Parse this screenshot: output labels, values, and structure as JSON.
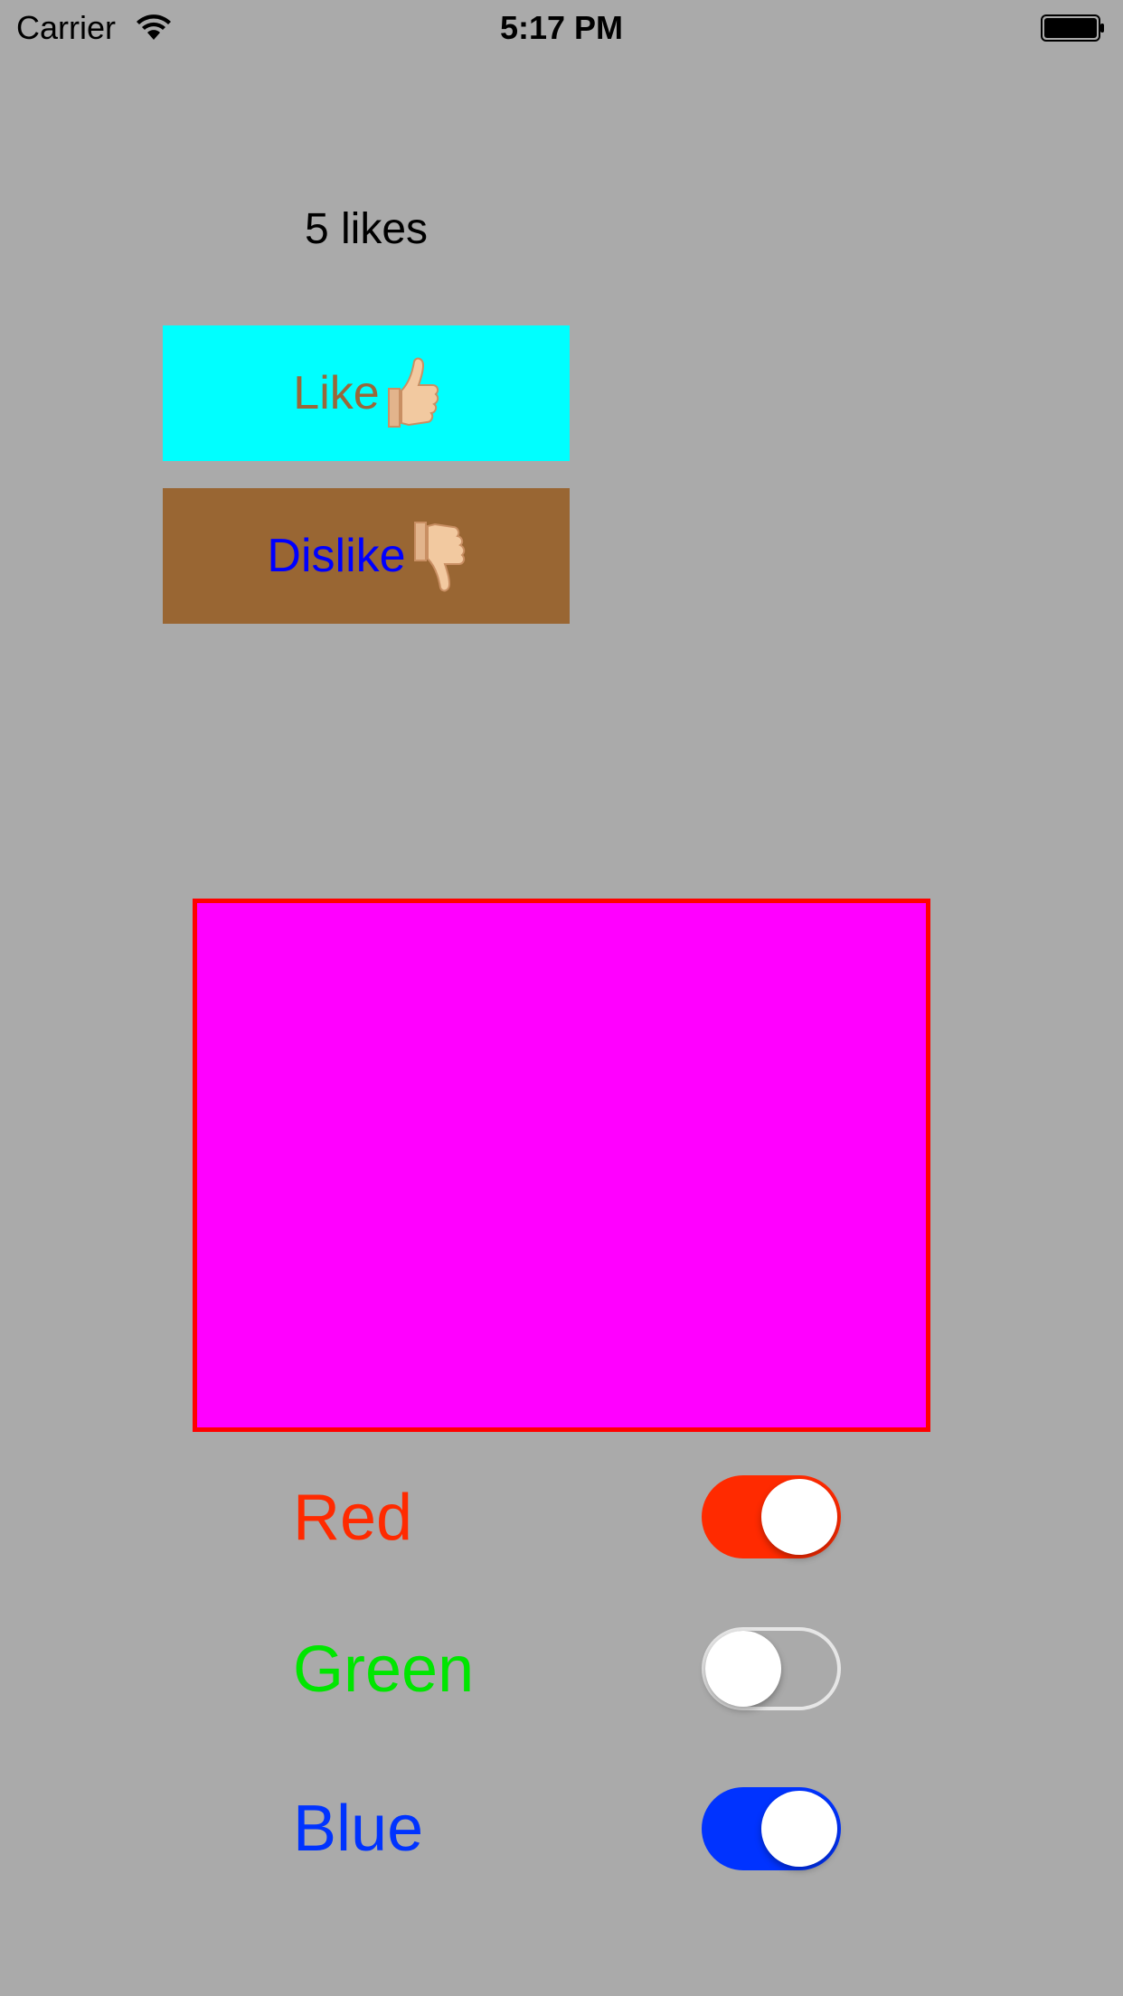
{
  "status_bar": {
    "carrier": "Carrier",
    "time": "5:17 PM"
  },
  "likes": {
    "count_label": "5 likes"
  },
  "buttons": {
    "like_label": "Like",
    "like_bg": "#00ffff",
    "like_text_color": "#99673a",
    "dislike_label": "Dislike",
    "dislike_bg": "#996633",
    "dislike_text_color": "#0000ff"
  },
  "color_box": {
    "fill": "#ff00ff",
    "border": "#ff0000"
  },
  "switches": [
    {
      "label": "Red",
      "color": "#ff2a00",
      "on": true
    },
    {
      "label": "Green",
      "color": "#00e600",
      "on": false
    },
    {
      "label": "Blue",
      "color": "#0033ff",
      "on": true
    }
  ]
}
